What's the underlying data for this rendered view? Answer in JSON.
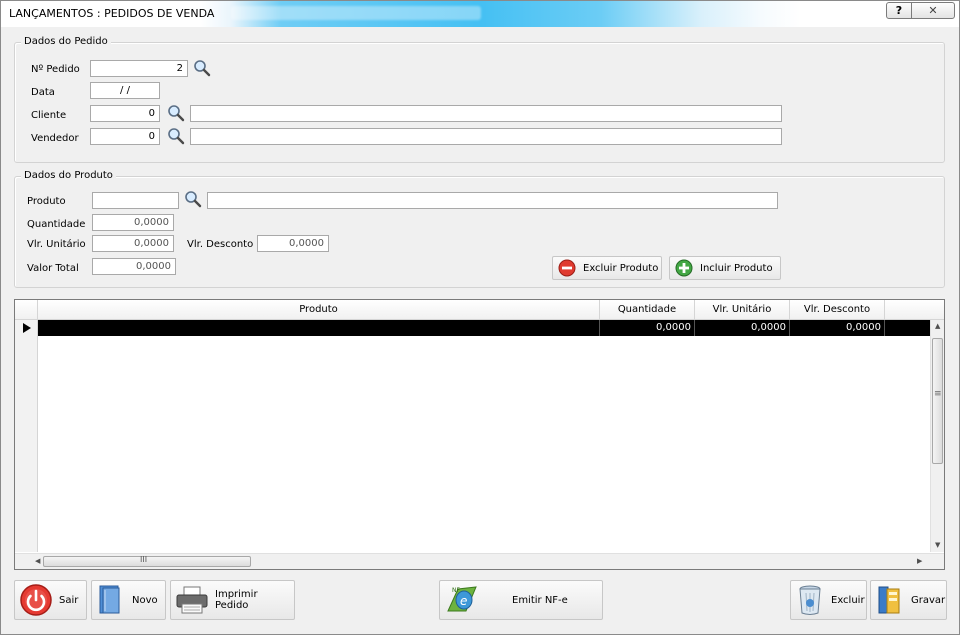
{
  "window": {
    "title": "LANÇAMENTOS : PEDIDOS DE VENDA",
    "help_label": "?",
    "close_label": "✕"
  },
  "pedido": {
    "group_label": "Dados do Pedido",
    "numero_label": "Nº Pedido",
    "numero_value": "2",
    "data_label": "Data",
    "data_value": " /  /",
    "cliente_label": "Cliente",
    "cliente_code": "0",
    "cliente_name": "",
    "vendedor_label": "Vendedor",
    "vendedor_code": "0",
    "vendedor_name": ""
  },
  "produto": {
    "group_label": "Dados do Produto",
    "produto_label": "Produto",
    "produto_code": "",
    "produto_name": "",
    "quantidade_label": "Quantidade",
    "quantidade_value": "0,0000",
    "vlr_unitario_label": "Vlr. Unitário",
    "vlr_unitario_value": "0,0000",
    "vlr_desconto_label": "Vlr. Desconto",
    "vlr_desconto_value": "0,0000",
    "valor_total_label": "Valor Total",
    "valor_total_value": "0,0000",
    "excluir_label": "Excluir Produto",
    "incluir_label": "Incluir Produto"
  },
  "grid": {
    "columns": [
      "Produto",
      "Quantidade",
      "Vlr. Unitário",
      "Vlr. Desconto"
    ],
    "rows": [
      {
        "produto": "",
        "quantidade": "0,0000",
        "vlr_unitario": "0,0000",
        "vlr_desconto": "0,0000"
      }
    ],
    "scroll_grip": "III",
    "vscroll_grip": "≡"
  },
  "toolbar": {
    "sair": "Sair",
    "novo": "Novo",
    "imprimir": "Imprimir Pedido",
    "emitir": "Emitir NF-e",
    "excluir": "Excluir",
    "gravar": "Gravar"
  },
  "icons": {
    "search": "magnifier-icon",
    "accent": "#45c0f3"
  }
}
